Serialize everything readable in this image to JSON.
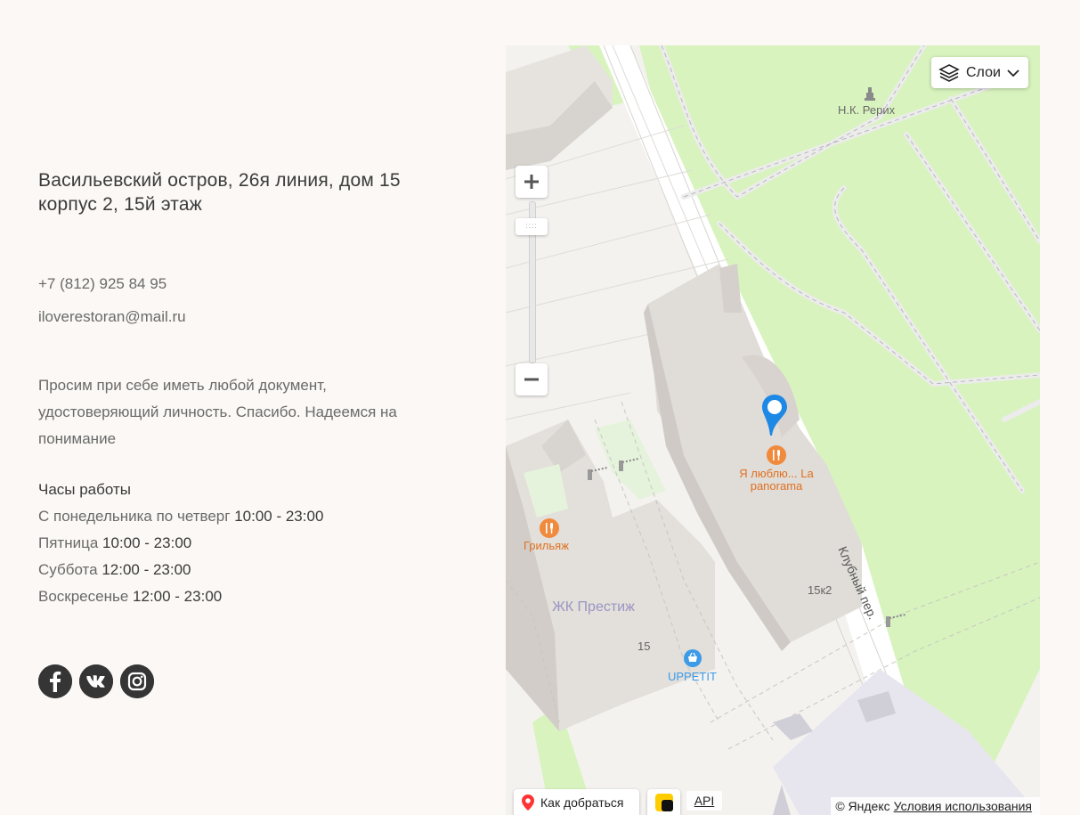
{
  "address": "Васильевский остров, 26я линия, дом 15 корпус 2, 15й этаж",
  "phone": "+7 (812) 925 84 95",
  "email": "iloverestoran@mail.ru",
  "note": "Просим при себе иметь любой документ, удостоверяющий личность. Спасибо. Надеемся на понимание",
  "hours": {
    "title": "Часы работы",
    "rows": [
      {
        "days": "С понедельника по четверг",
        "time": "10:00 - 23:00"
      },
      {
        "days": "Пятница",
        "time": "10:00 - 23:00"
      },
      {
        "days": "Суббота",
        "time": "12:00 - 23:00"
      },
      {
        "days": "Воскресенье",
        "time": "12:00 - 23:00"
      }
    ]
  },
  "socials": [
    {
      "name": "facebook",
      "icon": "facebook-icon"
    },
    {
      "name": "vk",
      "icon": "vk-icon"
    },
    {
      "name": "instagram",
      "icon": "instagram-icon"
    }
  ],
  "map": {
    "layers_label": "Слои",
    "route_label": "Как добраться",
    "api_label": "API",
    "copyright": "© Яндекс",
    "terms_label": "Условия использования",
    "labels": {
      "monument": "Н.К. Рерих",
      "restaurant": "Я люблю... La panorama",
      "grill": "Грильяж",
      "complex": "ЖК Престиж",
      "house15": "15",
      "house15k2": "15к2",
      "shop": "UPPETIT",
      "street": "Клубный пер."
    },
    "colors": {
      "park": "#d6f2bc",
      "building": "#dcd7d2",
      "accent_orange": "#f08a3c",
      "marker_blue": "#1e88e5"
    }
  }
}
